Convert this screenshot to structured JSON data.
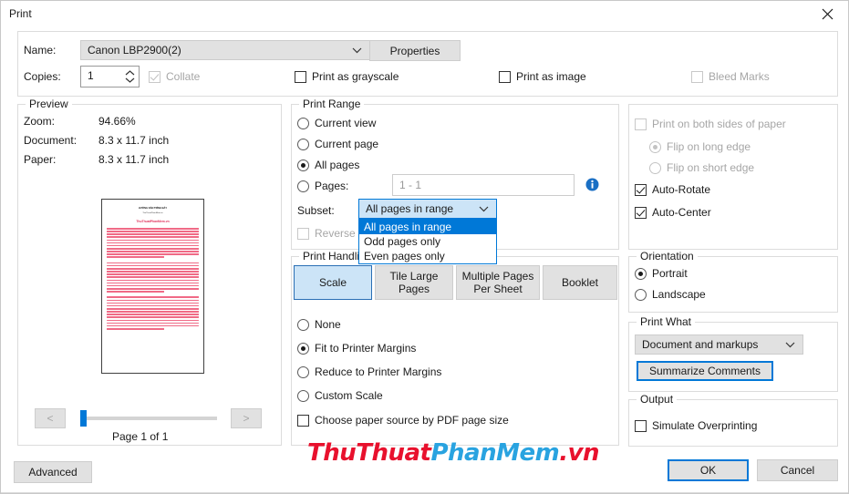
{
  "window": {
    "title": "Print",
    "close_icon": "close-icon"
  },
  "printer": {
    "name_label": "Name:",
    "name_value": "Canon LBP2900(2)",
    "properties_button": "Properties",
    "copies_label": "Copies:",
    "copies_value": "1",
    "collate_label": "Collate",
    "print_as_grayscale_label": "Print as grayscale",
    "print_as_image_label": "Print as image",
    "bleed_marks_label": "Bleed Marks"
  },
  "preview": {
    "legend": "Preview",
    "zoom_label": "Zoom:",
    "zoom_value": "94.66%",
    "document_label": "Document:",
    "document_value": "8.3 x 11.7 inch",
    "paper_label": "Paper:",
    "paper_value": "8.3 x 11.7 inch",
    "prev_button": "<",
    "next_button": ">",
    "page_status": "Page 1 of 1",
    "thumb_title": "HƯỚNG DẪN TRÌNH BÀY",
    "thumb_subtitle": "ThuThuatPhanMem.vn",
    "thumb_watermark": "ThuThuatPhanMem.vn"
  },
  "advanced_button": "Advanced",
  "print_range": {
    "legend": "Print Range",
    "options": [
      {
        "label": "Current view",
        "selected": false
      },
      {
        "label": "Current page",
        "selected": false
      },
      {
        "label": "All pages",
        "selected": true
      },
      {
        "label": "Pages:",
        "selected": false
      }
    ],
    "pages_value": "1 - 1",
    "info_icon": "info-icon",
    "subset_label": "Subset:",
    "subset_value": "All pages in range",
    "subset_options": [
      "All pages in range",
      "Odd pages only",
      "Even pages only"
    ],
    "subset_selected_index": 0,
    "reverse_pages_label": "Reverse pages"
  },
  "print_handling": {
    "legend": "Print Handling",
    "tabs": [
      {
        "label": "Scale",
        "active": true
      },
      {
        "label": "Tile Large\nPages",
        "active": false
      },
      {
        "label": "Multiple Pages\nPer Sheet",
        "active": false
      },
      {
        "label": "Booklet",
        "active": false
      }
    ],
    "tab_labels": {
      "scale": "Scale",
      "tile_large_pages_line1": "Tile Large",
      "tile_large_pages_line2": "Pages",
      "multiple_pages_line1": "Multiple Pages",
      "multiple_pages_line2": "Per Sheet",
      "booklet": "Booklet"
    },
    "scale_options": [
      {
        "label": "None",
        "selected": false
      },
      {
        "label": "Fit to Printer Margins",
        "selected": true
      },
      {
        "label": "Reduce to Printer Margins",
        "selected": false
      },
      {
        "label": "Custom Scale",
        "selected": false
      }
    ],
    "choose_paper_source_label": "Choose paper source by PDF page size"
  },
  "duplex": {
    "print_both_sides_label": "Print on both sides of paper",
    "flip_long_edge_label": "Flip on long edge",
    "flip_short_edge_label": "Flip on short edge",
    "auto_rotate_label": "Auto-Rotate",
    "auto_center_label": "Auto-Center"
  },
  "orientation": {
    "legend": "Orientation",
    "options": [
      {
        "label": "Portrait",
        "selected": true
      },
      {
        "label": "Landscape",
        "selected": false
      }
    ]
  },
  "print_what": {
    "legend": "Print What",
    "value": "Document and markups",
    "summarize_button": "Summarize Comments"
  },
  "output": {
    "legend": "Output",
    "simulate_overprinting_label": "Simulate Overprinting"
  },
  "footer": {
    "ok_button": "OK",
    "cancel_button": "Cancel"
  },
  "watermark": {
    "part1": "ThuThuat",
    "part2": "PhanMem",
    "part3": ".vn",
    "color_red": "#e8112d",
    "color_blue": "#29a3e0"
  },
  "theme": {
    "accent": "#0078d7",
    "selection_bg": "#cce4f7",
    "control_bg": "#e1e1e1"
  }
}
